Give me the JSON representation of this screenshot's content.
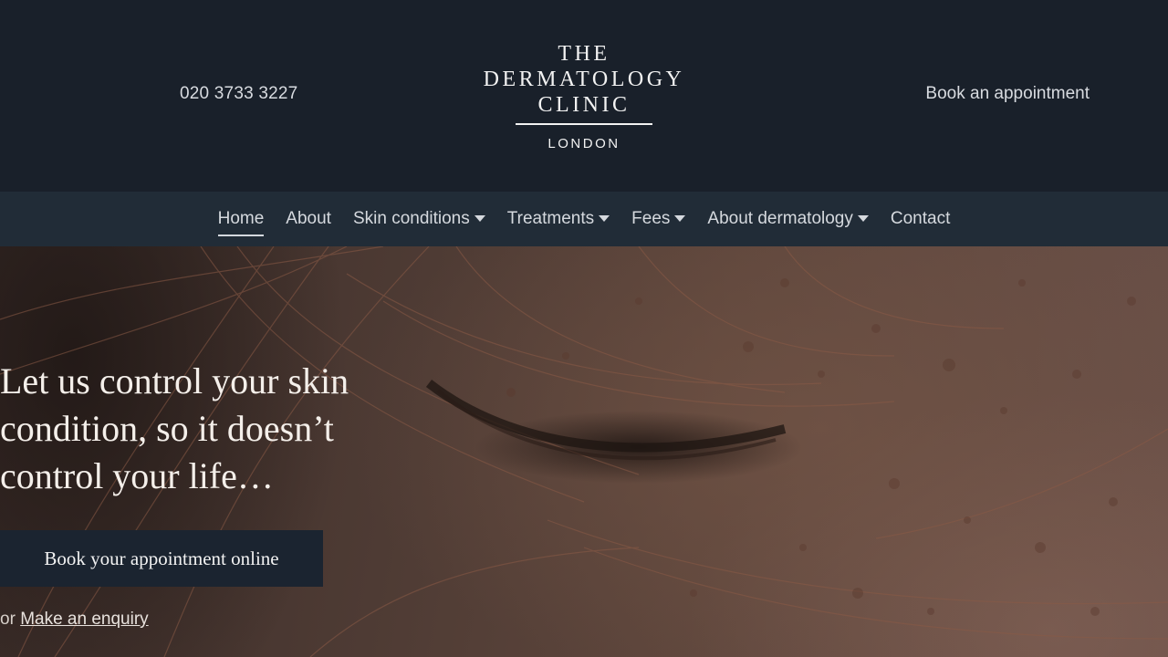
{
  "header": {
    "phone": "020 3733 3227",
    "book_link": "Book an appointment",
    "logo": {
      "line1": "THE",
      "line2": "DERMATOLOGY",
      "line3": "CLINIC",
      "line4": "LONDON"
    }
  },
  "nav": {
    "items": [
      {
        "label": "Home",
        "active": true,
        "dropdown": false
      },
      {
        "label": "About",
        "active": false,
        "dropdown": false
      },
      {
        "label": "Skin conditions",
        "active": false,
        "dropdown": true
      },
      {
        "label": "Treatments",
        "active": false,
        "dropdown": true
      },
      {
        "label": "Fees",
        "active": false,
        "dropdown": true
      },
      {
        "label": "About dermatology",
        "active": false,
        "dropdown": true
      },
      {
        "label": "Contact",
        "active": false,
        "dropdown": false
      }
    ]
  },
  "hero": {
    "headline": "Let us control your skin condition, so it doesn’t control your life…",
    "cta_label": "Book your appointment online",
    "alt_prefix": "or",
    "alt_link": "Make an enquiry"
  },
  "colors": {
    "header_bg": "#19202a",
    "nav_bg": "#212c37",
    "cta_bg": "#1b2430"
  }
}
